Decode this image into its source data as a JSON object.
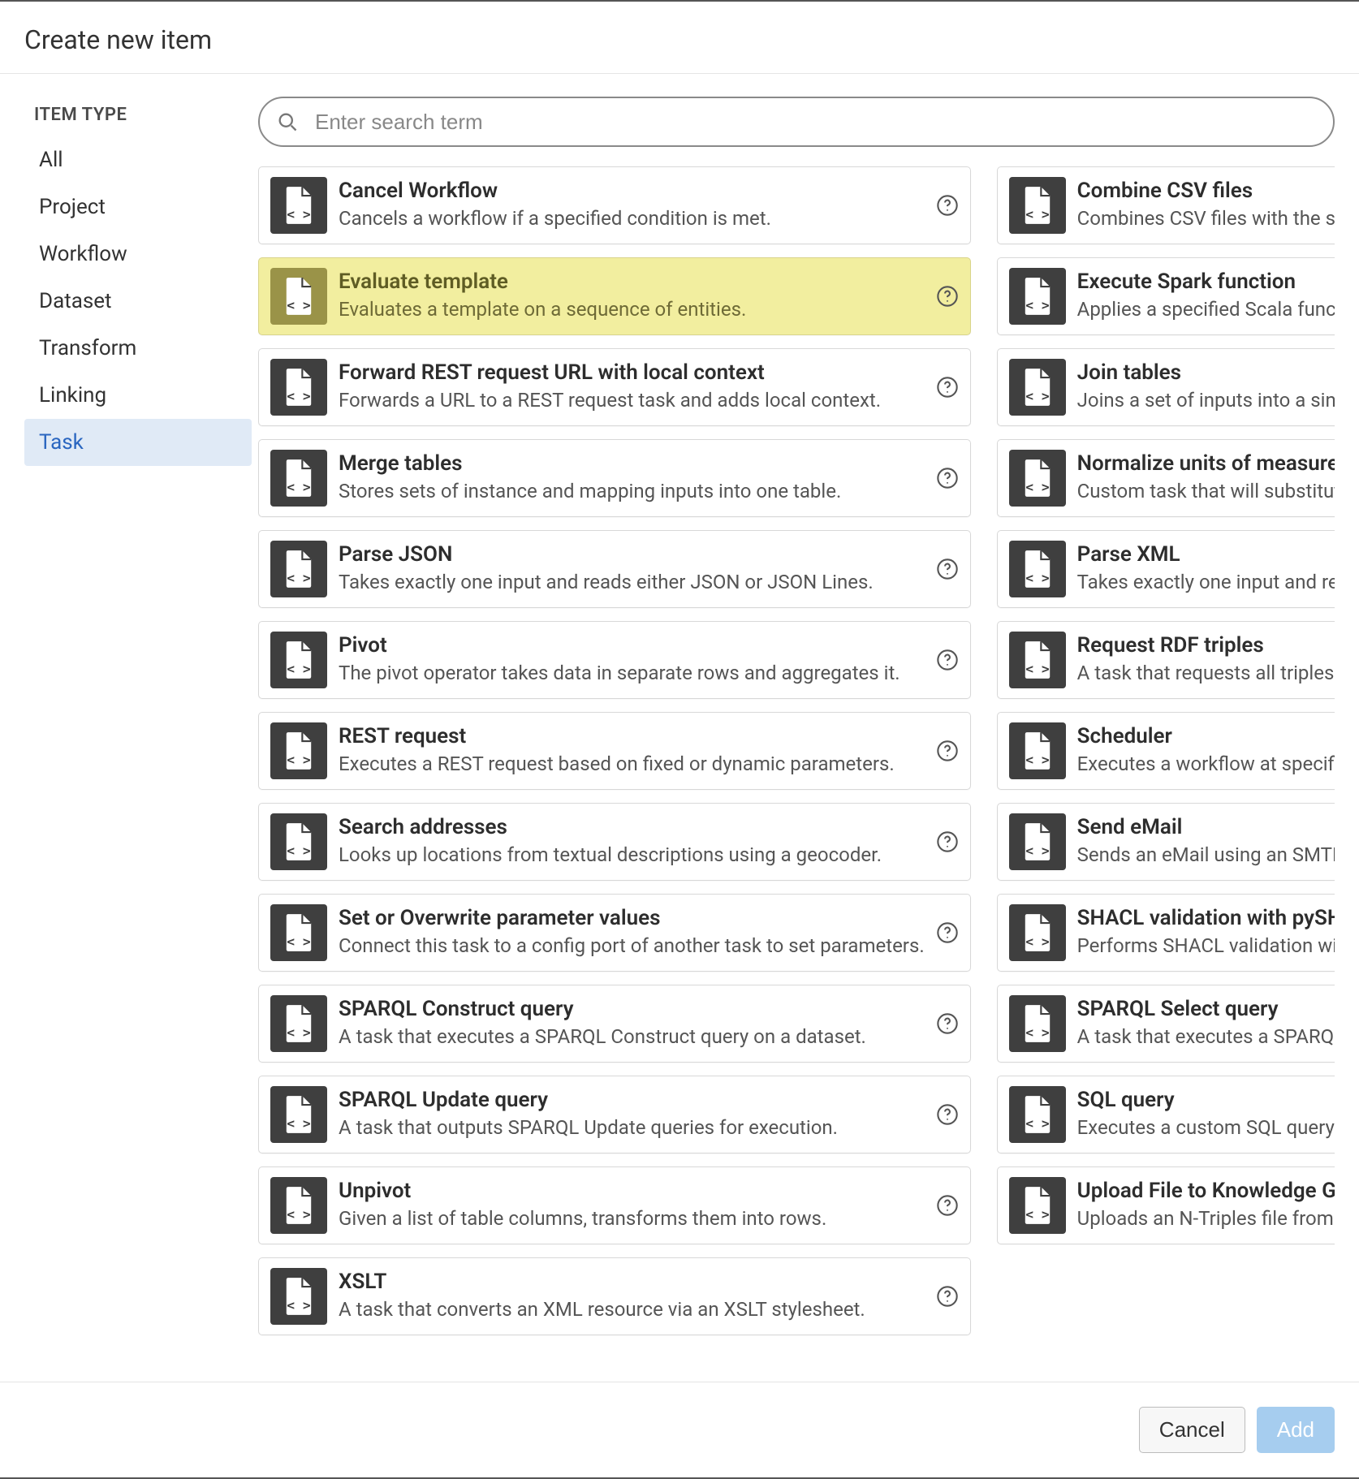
{
  "dialog": {
    "title": "Create new item"
  },
  "sidebar": {
    "heading": "ITEM TYPE",
    "items": [
      {
        "label": "All",
        "selected": false
      },
      {
        "label": "Project",
        "selected": false
      },
      {
        "label": "Workflow",
        "selected": false
      },
      {
        "label": "Dataset",
        "selected": false
      },
      {
        "label": "Transform",
        "selected": false
      },
      {
        "label": "Linking",
        "selected": false
      },
      {
        "label": "Task",
        "selected": true
      }
    ]
  },
  "search": {
    "placeholder": "Enter search term",
    "value": ""
  },
  "items": [
    {
      "title": "Cancel Workflow",
      "desc": "Cancels a workflow if a specified condition is met.",
      "highlighted": false
    },
    {
      "title": "Combine CSV files",
      "desc": "Combines CSV files with the same structure into one file.",
      "highlighted": false
    },
    {
      "title": "Evaluate template",
      "desc": "Evaluates a template on a sequence of entities.",
      "highlighted": true
    },
    {
      "title": "Execute Spark function",
      "desc": "Applies a specified Scala function to a set of inputs.",
      "highlighted": false
    },
    {
      "title": "Forward REST request URL with local context",
      "desc": "Forwards a URL to a REST request task and adds local context.",
      "highlighted": false
    },
    {
      "title": "Join tables",
      "desc": "Joins a set of inputs into a single table. Supports inner, outer and cross joins.",
      "highlighted": false
    },
    {
      "title": "Merge tables",
      "desc": "Stores sets of instance and mapping inputs into one table.",
      "highlighted": false
    },
    {
      "title": "Normalize units of measurement",
      "desc": "Custom task that will substitute numeric values with normalized units.",
      "highlighted": false
    },
    {
      "title": "Parse JSON",
      "desc": "Takes exactly one input and reads either JSON or JSON Lines.",
      "highlighted": false
    },
    {
      "title": "Parse XML",
      "desc": "Takes exactly one input and reads either a single XML document.",
      "highlighted": false
    },
    {
      "title": "Pivot",
      "desc": "The pivot operator takes data in separate rows and aggregates it.",
      "highlighted": false
    },
    {
      "title": "Request RDF triples",
      "desc": "A task that requests all triples from an RDF endpoint.",
      "highlighted": false
    },
    {
      "title": "REST request",
      "desc": "Executes a REST request based on fixed or dynamic parameters.",
      "highlighted": false
    },
    {
      "title": "Scheduler",
      "desc": "Executes a workflow at specified intervals.",
      "highlighted": false
    },
    {
      "title": "Search addresses",
      "desc": "Looks up locations from textual descriptions using a geocoder.",
      "highlighted": false
    },
    {
      "title": "Send eMail",
      "desc": "Sends an eMail using an SMTP server. If needed, attachments can be added.",
      "highlighted": false
    },
    {
      "title": "Set or Overwrite parameter values",
      "desc": "Connect this task to a config port of another task to set parameters.",
      "highlighted": false
    },
    {
      "title": "SHACL validation with pySHACL",
      "desc": "Performs SHACL validation with pySHACL on an RDF dataset.",
      "highlighted": false
    },
    {
      "title": "SPARQL Construct query",
      "desc": "A task that executes a SPARQL Construct query on a dataset.",
      "highlighted": false
    },
    {
      "title": "SPARQL Select query",
      "desc": "A task that executes a SPARQL Select query on a dataset.",
      "highlighted": false
    },
    {
      "title": "SPARQL Update query",
      "desc": "A task that outputs SPARQL Update queries for execution.",
      "highlighted": false
    },
    {
      "title": "SQL query",
      "desc": "Executes a custom SQL query on the first connected input.",
      "highlighted": false
    },
    {
      "title": "Unpivot",
      "desc": "Given a list of table columns, transforms them into rows.",
      "highlighted": false
    },
    {
      "title": "Upload File to Knowledge Graph",
      "desc": "Uploads an N-Triples file from the file repository to a graph.",
      "highlighted": false
    },
    {
      "title": "XSLT",
      "desc": "A task that converts an XML resource via an XSLT stylesheet.",
      "highlighted": false
    }
  ],
  "footer": {
    "cancel": "Cancel",
    "add": "Add"
  }
}
